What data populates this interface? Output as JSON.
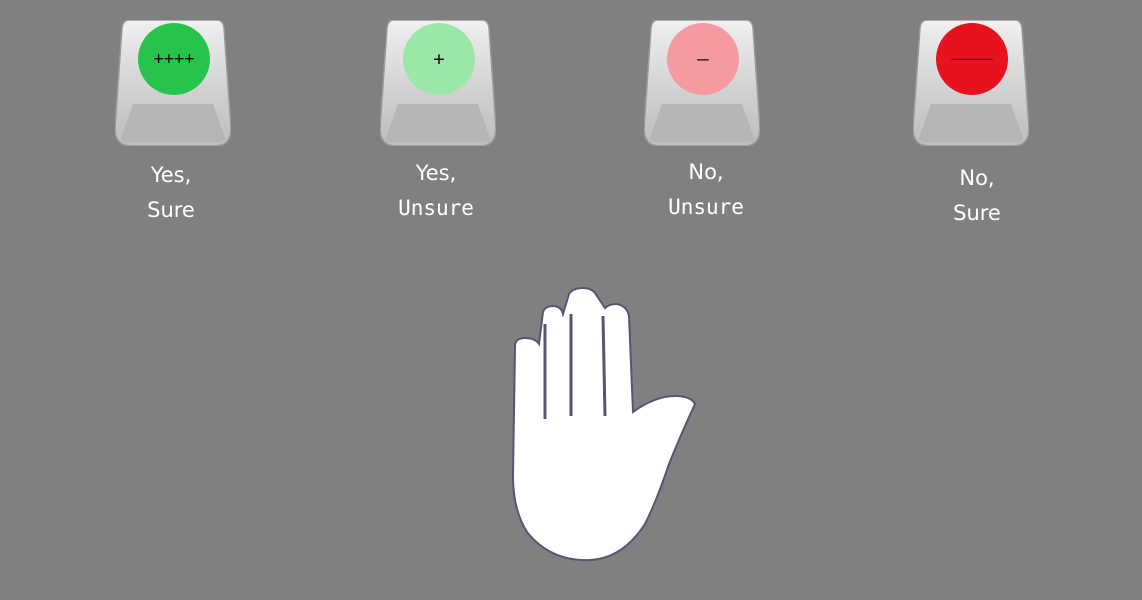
{
  "options": [
    {
      "symbol": "++++",
      "color": "#26c44d",
      "line1": "Yes,",
      "line2": "Sure"
    },
    {
      "symbol": "+",
      "color": "#9be7a8",
      "line1": "Yes,",
      "line2": "Unsure"
    },
    {
      "symbol": "–",
      "color": "#f59aa0",
      "line1": "No,",
      "line2": "Unsure"
    },
    {
      "symbol": "––––",
      "color": "#e8121f",
      "line1": "No,",
      "line2": "Sure"
    }
  ],
  "hand_icon": "raised-hand-icon"
}
